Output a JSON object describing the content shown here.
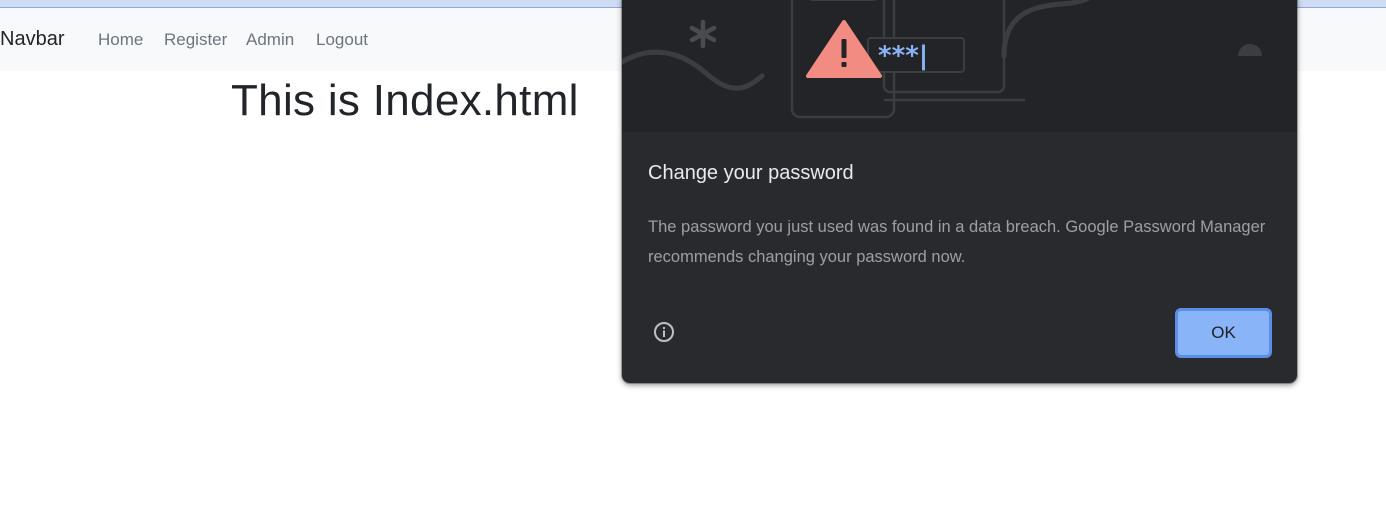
{
  "navbar": {
    "brand": "Navbar",
    "links": [
      "Home",
      "Register",
      "Admin",
      "Logout"
    ]
  },
  "main": {
    "heading": "This is Index.html"
  },
  "dialog": {
    "illustration_password_mask": "***|",
    "title": "Change your password",
    "body": "The password you just used was found in a data breach. Google Password Manager recommends changing your password now.",
    "ok_label": "OK",
    "icons": [
      "warning-icon",
      "info-icon"
    ],
    "colors": {
      "dialog_bg": "#292a2d",
      "illustration_bg": "#232427",
      "accent": "#8ab4f8",
      "warning": "#f28b82"
    }
  }
}
